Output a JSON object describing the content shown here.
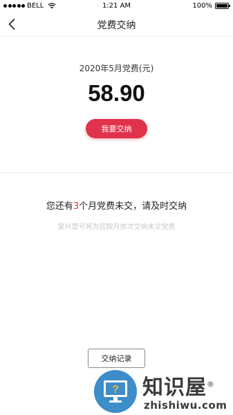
{
  "status_bar": {
    "carrier": "BELL",
    "time": "1:21 AM",
    "battery_percent": "100%",
    "battery_level": 1.0,
    "icons": [
      "signal-dots-icon",
      "wifi-icon",
      "battery-icon"
    ]
  },
  "nav": {
    "title": "党费交纳",
    "back_icon": "chevron-left-icon"
  },
  "fee": {
    "label": "2020年5月党费(元)",
    "amount": "58.90",
    "pay_button_label": "我要交纳"
  },
  "reminder": {
    "prefix": "您还有",
    "count": "3",
    "suffix": "个月党费未交，请及时交纳",
    "note": "复兴壹号将为您按月依次交纳未交党费"
  },
  "records_button_label": "交纳记录",
  "watermark": {
    "title": "知识屋",
    "registered_mark": "®",
    "subtitle": "zhishiwu.com",
    "icon": "question-monitor-icon"
  },
  "colors": {
    "accent": "#e0324b",
    "muted_text": "#c8c8c8",
    "divider": "#eeeeee",
    "watermark_blue": "#3c8dc8"
  }
}
